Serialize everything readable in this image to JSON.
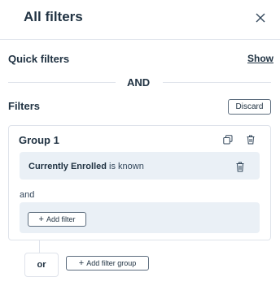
{
  "panel": {
    "title": "All filters"
  },
  "quick_filters": {
    "label": "Quick filters",
    "show_link": "Show"
  },
  "separator": {
    "label": "AND"
  },
  "filters": {
    "label": "Filters",
    "discard_label": "Discard"
  },
  "group": {
    "title": "Group 1",
    "condition": {
      "property": "Currently Enrolled",
      "operator": "is known"
    },
    "connector": "and",
    "add_filter_label": "Add filter"
  },
  "footer": {
    "or_label": "or",
    "add_group_label": "Add filter group"
  },
  "icons": {
    "close": "close-icon",
    "copy": "copy-icon",
    "delete": "trash-icon"
  }
}
